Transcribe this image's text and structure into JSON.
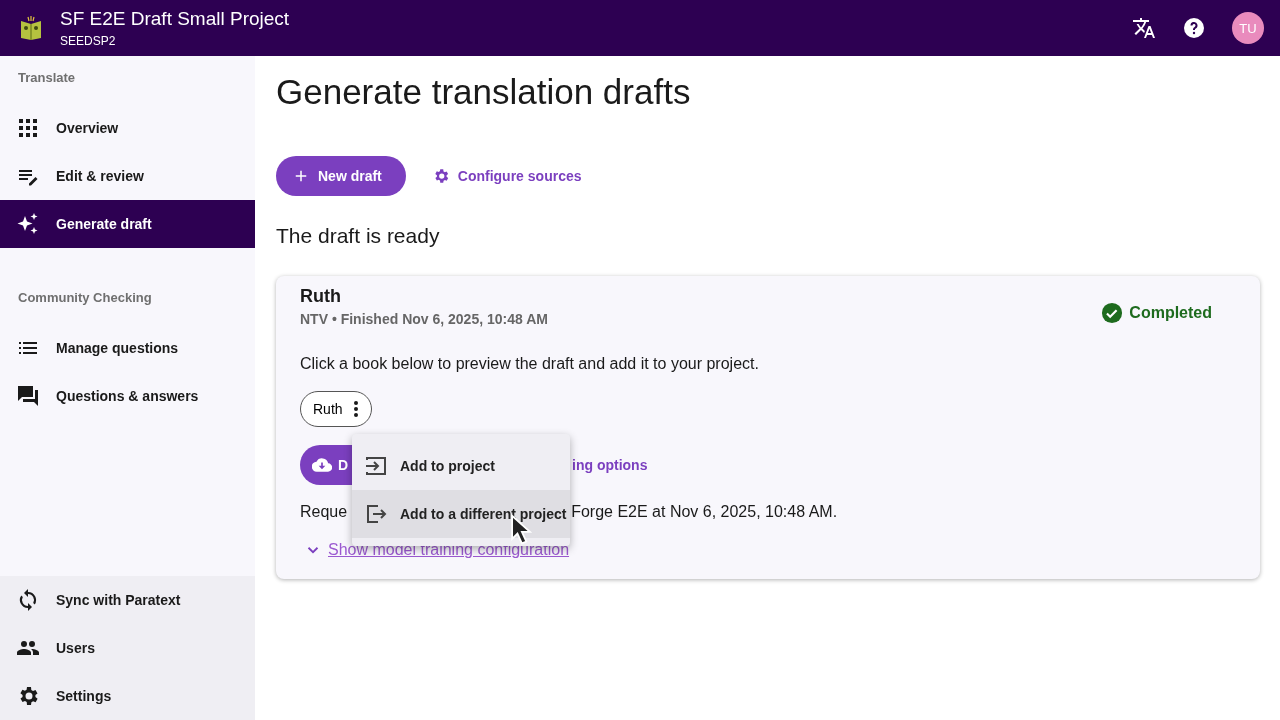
{
  "app_bar": {
    "title": "SF E2E Draft Small Project",
    "subtitle": "SEEDSP2",
    "avatar": "TU"
  },
  "sidebar": {
    "sections": [
      {
        "heading": "Translate",
        "items": [
          {
            "label": "Overview",
            "selected": false
          },
          {
            "label": "Edit & review",
            "selected": false
          },
          {
            "label": "Generate draft",
            "selected": true
          }
        ]
      },
      {
        "heading": "Community Checking",
        "items": [
          {
            "label": "Manage questions",
            "selected": false
          },
          {
            "label": "Questions & answers",
            "selected": false
          }
        ]
      }
    ],
    "footer_items": [
      {
        "label": "Sync with Paratext",
        "selected": false
      },
      {
        "label": "Users",
        "selected": false
      },
      {
        "label": "Settings",
        "selected": false
      }
    ]
  },
  "page": {
    "title": "Generate translation drafts",
    "new_draft_button": "New draft",
    "configure_link": "Configure sources",
    "status_heading": "The draft is ready"
  },
  "draft_card": {
    "title": "Ruth",
    "meta": "NTV • Finished Nov 6, 2025, 10:48 AM",
    "status": "Completed",
    "instruction": "Click a book below to preview the draft and add it to your project.",
    "book_chip": "Ruth",
    "download_button": "D",
    "options_link": "ing options",
    "requested_start": "Reque",
    "requested_end": "Forge E2E at Nov 6, 2025, 10:48 AM.",
    "training_link": "Show model training configuration"
  },
  "book_menu": {
    "items": [
      {
        "label": "Add to project",
        "hovered": false
      },
      {
        "label": "Add to a different project",
        "hovered": true
      }
    ]
  }
}
